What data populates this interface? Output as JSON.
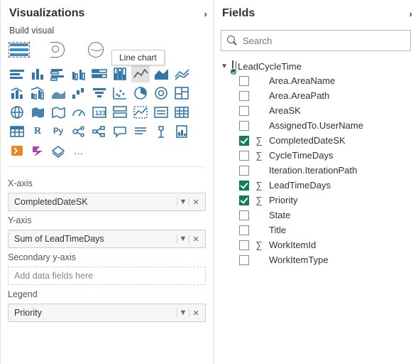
{
  "viz_pane": {
    "title": "Visualizations",
    "subtitle": "Build visual",
    "tooltip": "Line chart",
    "wells": {
      "xaxis": {
        "label": "X-axis",
        "value": "CompletedDateSK"
      },
      "yaxis": {
        "label": "Y-axis",
        "value": "Sum of LeadTimeDays"
      },
      "y2axis": {
        "label": "Secondary y-axis",
        "placeholder": "Add data fields here"
      },
      "legend": {
        "label": "Legend",
        "value": "Priority"
      }
    }
  },
  "fields_pane": {
    "title": "Fields",
    "search_placeholder": "Search",
    "table": "LeadCycleTime",
    "fields": [
      {
        "name": "Area.AreaName",
        "checked": false,
        "agg": false
      },
      {
        "name": "Area.AreaPath",
        "checked": false,
        "agg": false
      },
      {
        "name": "AreaSK",
        "checked": false,
        "agg": false
      },
      {
        "name": "AssignedTo.UserName",
        "checked": false,
        "agg": false
      },
      {
        "name": "CompletedDateSK",
        "checked": true,
        "agg": true
      },
      {
        "name": "CycleTimeDays",
        "checked": false,
        "agg": true
      },
      {
        "name": "Iteration.IterationPath",
        "checked": false,
        "agg": false
      },
      {
        "name": "LeadTimeDays",
        "checked": true,
        "agg": true
      },
      {
        "name": "Priority",
        "checked": true,
        "agg": true
      },
      {
        "name": "State",
        "checked": false,
        "agg": false
      },
      {
        "name": "Title",
        "checked": false,
        "agg": false
      },
      {
        "name": "WorkItemId",
        "checked": false,
        "agg": true
      },
      {
        "name": "WorkItemType",
        "checked": false,
        "agg": false
      }
    ]
  },
  "chart_data": {
    "type": "icon-gallery",
    "note": "No plotted data; screenshot shows configuration panes only."
  }
}
